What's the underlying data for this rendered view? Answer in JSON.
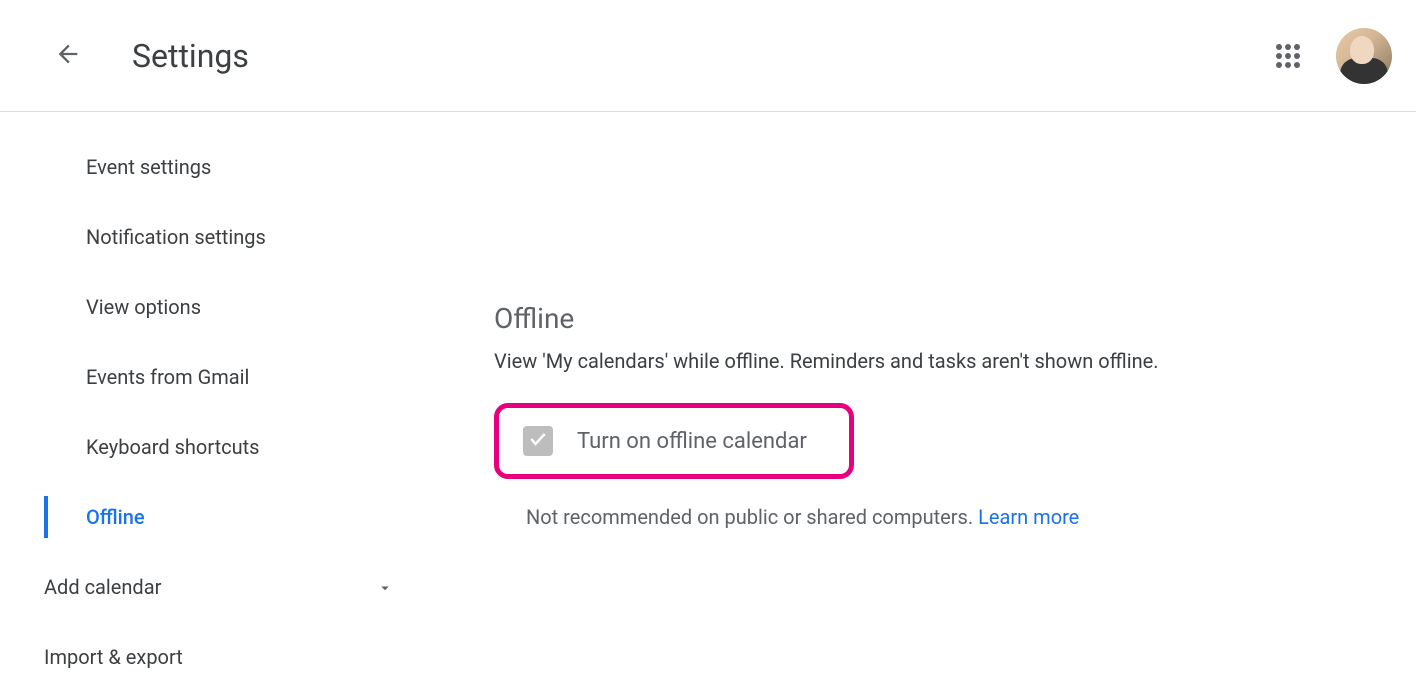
{
  "header": {
    "title": "Settings"
  },
  "sidebar": {
    "items": [
      {
        "label": "Event settings"
      },
      {
        "label": "Notification settings"
      },
      {
        "label": "View options"
      },
      {
        "label": "Events from Gmail"
      },
      {
        "label": "Keyboard shortcuts"
      },
      {
        "label": "Offline",
        "active": true
      }
    ],
    "sections": [
      {
        "label": "Add calendar"
      },
      {
        "label": "Import & export"
      }
    ]
  },
  "main": {
    "offline": {
      "title": "Offline",
      "description": "View 'My calendars' while offline. Reminders and tasks aren't shown offline.",
      "checkbox_label": "Turn on offline calendar",
      "note_prefix": "Not recommended on public or shared computers. ",
      "learn_more": "Learn more"
    }
  },
  "annotation": {
    "highlight_color": "#e6007e"
  }
}
